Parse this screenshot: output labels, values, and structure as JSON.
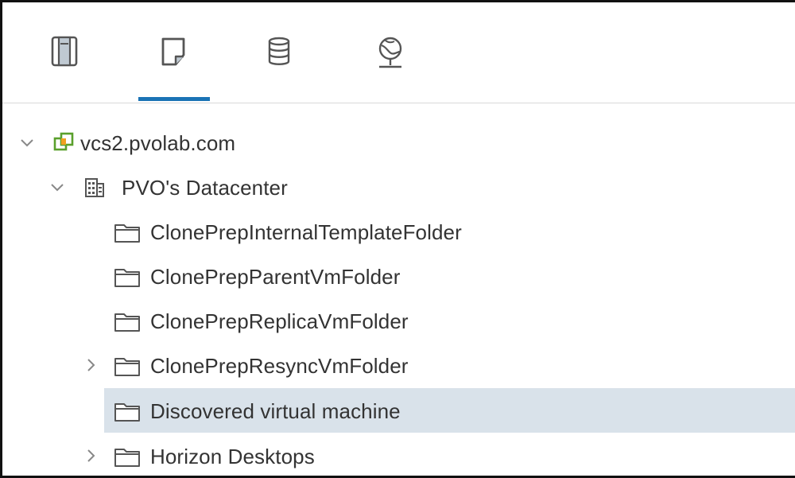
{
  "toolbar": {
    "tabs": [
      {
        "icon": "hosts-and-clusters-icon"
      },
      {
        "icon": "vms-and-templates-icon",
        "selected": true
      },
      {
        "icon": "storage-icon"
      },
      {
        "icon": "networking-icon"
      }
    ],
    "accent_color": "#1a73b5"
  },
  "tree": {
    "items": [
      {
        "label": "vcs2.pvolab.com",
        "icon": "vcenter-icon",
        "expanded": true
      },
      {
        "label": "PVO's Datacenter",
        "icon": "datacenter-icon",
        "expanded": true
      },
      {
        "label": "ClonePrepInternalTemplateFolder",
        "icon": "folder-icon"
      },
      {
        "label": "ClonePrepParentVmFolder",
        "icon": "folder-icon"
      },
      {
        "label": "ClonePrepReplicaVmFolder",
        "icon": "folder-icon"
      },
      {
        "label": "ClonePrepResyncVmFolder",
        "icon": "folder-icon",
        "collapsed": true
      },
      {
        "label": "Discovered virtual machine",
        "icon": "folder-icon",
        "selected": true
      },
      {
        "label": "Horizon Desktops",
        "icon": "folder-icon",
        "collapsed": true
      }
    ],
    "selected_color": "#d9e2ea"
  }
}
